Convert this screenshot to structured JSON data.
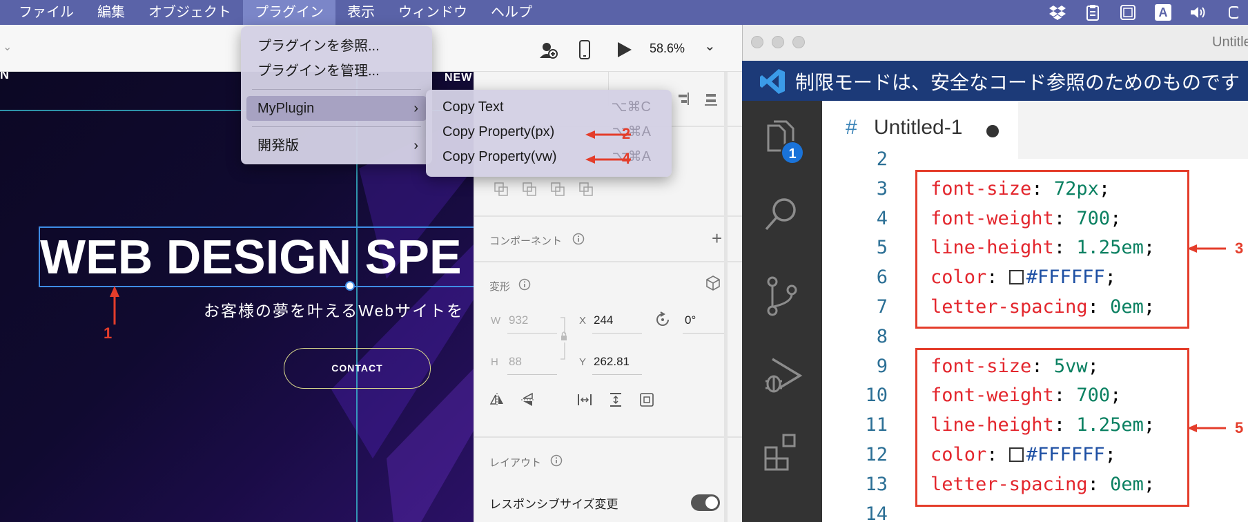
{
  "menubar": {
    "items": [
      "ファイル",
      "編集",
      "オブジェクト",
      "プラグイン",
      "表示",
      "ウィンドウ",
      "ヘルプ"
    ],
    "active_index": 3,
    "tray_icons": [
      "dropbox-icon",
      "clipboard-icon",
      "screen-icon",
      "input-source-icon",
      "volume-icon",
      "control-center-icon"
    ],
    "input_source_letter": "A"
  },
  "xd": {
    "toolbar": {
      "zoom": "58.6%"
    },
    "canvas": {
      "new_badge": "NEW",
      "headline": "WEB DESIGN SPE",
      "subtitle": "お客様の夢を叶えるWebサイトを",
      "contact_button": "CONTACT",
      "corner_letter": "N"
    },
    "plugin_menu": {
      "items": [
        {
          "label": "プラグインを参照..."
        },
        {
          "label": "プラグインを管理..."
        },
        {
          "label": "MyPlugin",
          "submenu": true
        },
        {
          "label": "開発版",
          "submenu": true
        }
      ]
    },
    "myplugin_submenu": {
      "items": [
        {
          "label": "Copy Text",
          "shortcut": "⌥⌘C"
        },
        {
          "label": "Copy Property(px)",
          "shortcut": "⌥⌘A"
        },
        {
          "label": "Copy Property(vw)",
          "shortcut": "⌥⌘A"
        }
      ]
    },
    "panel": {
      "component_label": "コンポーネント",
      "transform_label": "変形",
      "w_label": "W",
      "w_value": "932",
      "h_label": "H",
      "h_value": "88",
      "x_label": "X",
      "x_value": "244",
      "y_label": "Y",
      "y_value": "262.81",
      "rotation_value": "0°",
      "layout_label": "レイアウト",
      "responsive_label": "レスポンシブサイズ変更",
      "responsive_on": true
    }
  },
  "vscode": {
    "window_title": "Untitled",
    "banner_text": "制限モードは、安全なコード参照のためのものです",
    "explorer_badge": "1",
    "tab": {
      "hash": "#",
      "name": "Untitled-1"
    },
    "lines": [
      {
        "n": "2",
        "prop": "",
        "val": ""
      },
      {
        "n": "3",
        "prop": "font-size",
        "val": "72px",
        "kind": "num"
      },
      {
        "n": "4",
        "prop": "font-weight",
        "val": "700",
        "kind": "num"
      },
      {
        "n": "5",
        "prop": "line-height",
        "val": "1.25em",
        "kind": "num"
      },
      {
        "n": "6",
        "prop": "color",
        "val": "#FFFFFF",
        "kind": "hex"
      },
      {
        "n": "7",
        "prop": "letter-spacing",
        "val": "0em",
        "kind": "num"
      },
      {
        "n": "8",
        "prop": "",
        "val": ""
      },
      {
        "n": "9",
        "prop": "font-size",
        "val": "5vw",
        "kind": "num"
      },
      {
        "n": "10",
        "prop": "font-weight",
        "val": "700",
        "kind": "num"
      },
      {
        "n": "11",
        "prop": "line-height",
        "val": "1.25em",
        "kind": "num"
      },
      {
        "n": "12",
        "prop": "color",
        "val": "#FFFFFF",
        "kind": "hex"
      },
      {
        "n": "13",
        "prop": "letter-spacing",
        "val": "0em",
        "kind": "num"
      },
      {
        "n": "14",
        "prop": "",
        "val": ""
      }
    ]
  },
  "annotations": [
    "1",
    "2",
    "3",
    "4",
    "5"
  ],
  "colors": {
    "menubar": "#5a63a8",
    "annotation_red": "#e43d2b",
    "vscode_banner": "#1c3a78",
    "vscode_badge": "#1a73d9"
  }
}
